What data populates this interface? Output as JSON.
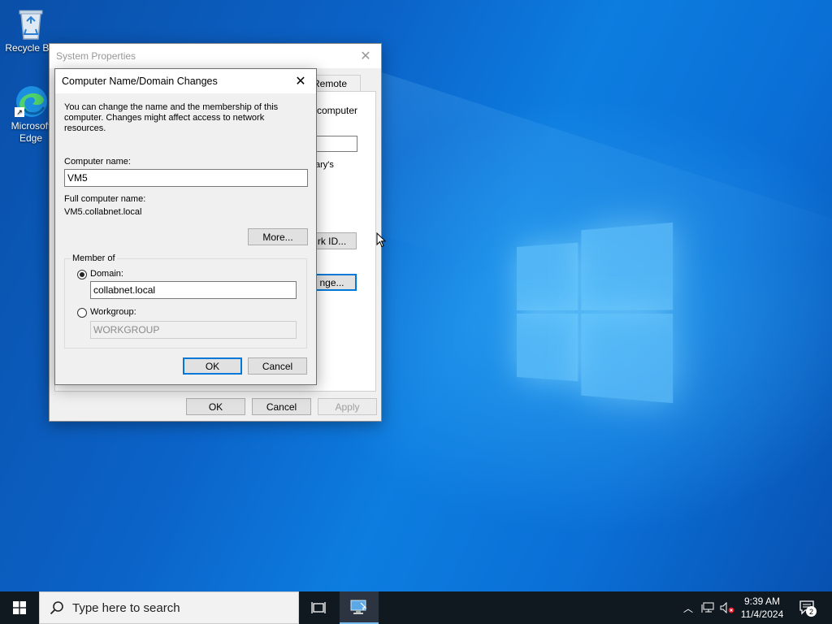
{
  "desktop": {
    "icons": [
      {
        "label": "Recycle Bin"
      },
      {
        "label": "Microsoft Edge"
      }
    ]
  },
  "system_properties": {
    "title": "System Properties",
    "tab_partial": "Remote",
    "text_partial_1": "computer",
    "text_partial_2": "ary's",
    "btn_network_id_partial": "rk ID...",
    "btn_change_partial": "nge...",
    "ok_label": "OK",
    "cancel_label": "Cancel",
    "apply_label": "Apply"
  },
  "domain_dialog": {
    "title": "Computer Name/Domain Changes",
    "description": "You can change the name and the membership of this computer. Changes might affect access to network resources.",
    "computer_name_label": "Computer name:",
    "computer_name_value": "VM5",
    "full_name_label": "Full computer name:",
    "full_name_value": "VM5.collabnet.local",
    "more_label": "More...",
    "member_of_label": "Member of",
    "domain_label": "Domain:",
    "domain_value": "collabnet.local",
    "workgroup_label": "Workgroup:",
    "workgroup_value": "WORKGROUP",
    "selected_membership": "domain",
    "ok_label": "OK",
    "cancel_label": "Cancel"
  },
  "taskbar": {
    "search_placeholder": "Type here to search",
    "time": "9:39 AM",
    "date": "11/4/2024",
    "notification_count": "2"
  },
  "colors": {
    "accent": "#0078d7",
    "taskbar": "#101820"
  }
}
